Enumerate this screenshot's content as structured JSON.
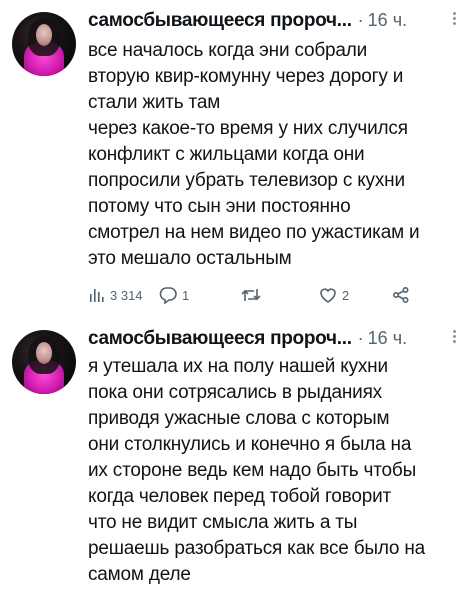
{
  "posts": [
    {
      "author": "самосбывающееся пророч...",
      "separator": "·",
      "time": "16 ч.",
      "lines": [
        "все началось когда эни собрали",
        "вторую квир-комунну через дорогу и",
        "стали жить там",
        "через какое-то время у них случился",
        "конфликт с жильцами когда они",
        "попросили убрать телевизор с кухни",
        "потому что сын эни постоянно",
        "смотрел на нем видео по ужастикам и",
        "это мешало остальным"
      ],
      "stats": {
        "views": "3 314",
        "replies": "1",
        "reposts": "",
        "likes": "2"
      }
    },
    {
      "author": "самосбывающееся пророч...",
      "separator": "·",
      "time": "16 ч.",
      "lines": [
        "я утешала их на полу нашей кухни",
        "пока они сотрясались в рыданиях",
        "приводя ужасные слова с которым",
        "они столкнулись и конечно я была на",
        "их стороне ведь кем надо быть чтобы",
        "когда человек перед тобой говорит",
        "что не видит смысла жить а ты",
        "решаешь разобраться как все было на",
        "самом деле"
      ]
    }
  ],
  "icons": [
    "views-icon",
    "reply-icon",
    "repost-icon",
    "like-icon",
    "share-icon",
    "more-icon"
  ]
}
